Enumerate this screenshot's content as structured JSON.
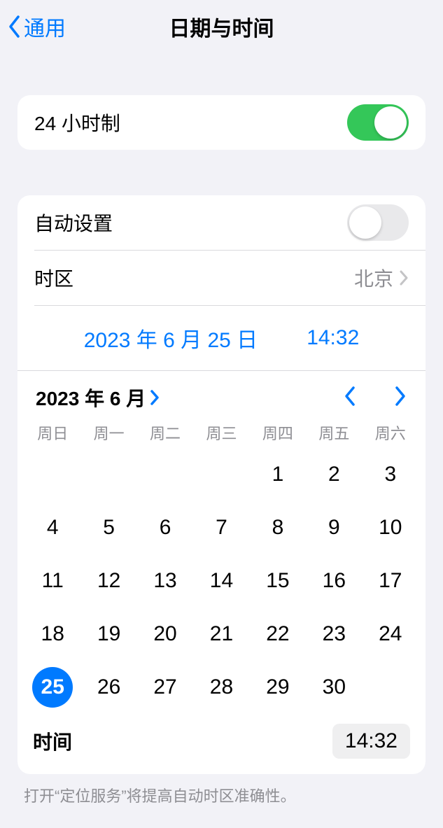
{
  "nav": {
    "back_label": "通用",
    "title": "日期与时间"
  },
  "hour24": {
    "label": "24 小时制",
    "on": true
  },
  "auto": {
    "label": "自动设置",
    "on": false
  },
  "timezone": {
    "label": "时区",
    "value": "北京"
  },
  "picker": {
    "date": "2023 年 6 月 25 日",
    "time": "14:32"
  },
  "calendar": {
    "month_label": "2023 年 6 月",
    "weekdays": [
      "周日",
      "周一",
      "周二",
      "周三",
      "周四",
      "周五",
      "周六"
    ],
    "blanks": 4,
    "days": [
      1,
      2,
      3,
      4,
      5,
      6,
      7,
      8,
      9,
      10,
      11,
      12,
      13,
      14,
      15,
      16,
      17,
      18,
      19,
      20,
      21,
      22,
      23,
      24,
      25,
      26,
      27,
      28,
      29,
      30
    ],
    "selected": 25
  },
  "time_row": {
    "label": "时间",
    "value": "14:32"
  },
  "footer": "打开“定位服务”将提高自动时区准确性。"
}
